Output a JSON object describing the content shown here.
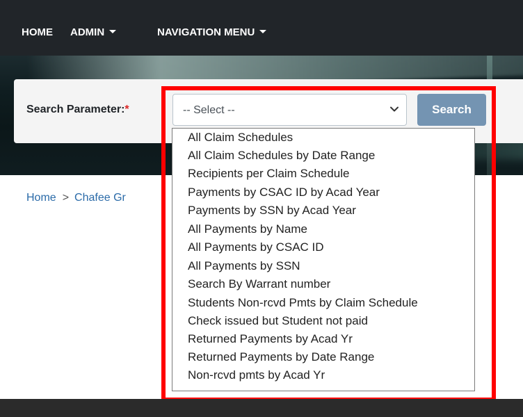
{
  "nav": {
    "home": "HOME",
    "admin": "ADMIN",
    "navigation_menu": "NAVIGATION MENU"
  },
  "search": {
    "label": "Search Parameter:",
    "required_mark": "*",
    "select_value": "-- Select --",
    "button_label": "Search"
  },
  "breadcrumb": {
    "home": "Home",
    "separator": ">",
    "current": "Chafee Gr"
  },
  "dropdown": {
    "options": [
      "All Claim Schedules",
      "All Claim Schedules by Date Range",
      "Recipients per Claim Schedule",
      "Payments by CSAC ID by Acad Year",
      "Payments by SSN by Acad Year",
      "All Payments by Name",
      "All Payments by CSAC ID",
      "All Payments by SSN",
      "Search By Warrant number",
      "Students Non-rcvd Pmts by Claim Schedule",
      "Check issued but Student not paid",
      "Returned Payments by Acad Yr",
      "Returned Payments by Date Range",
      "Non-rcvd pmts by Acad Yr"
    ]
  },
  "colors": {
    "navbar": "#212529",
    "search_button": "#7494b2",
    "highlight": "#ff0000",
    "required": "#dc2626",
    "link": "#2a6aa8"
  },
  "icons": {
    "admin_caret": "caret-down-icon",
    "nav_caret": "caret-down-icon",
    "select_chevron": "chevron-down-icon"
  }
}
